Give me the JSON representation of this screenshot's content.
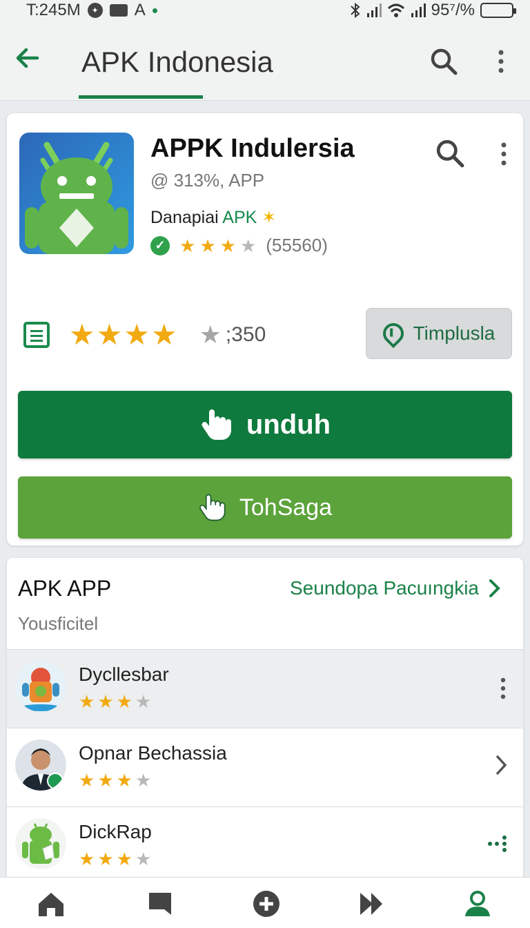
{
  "status_bar": {
    "time": "T:245M",
    "indicator_letter": "A",
    "battery_percent": "95⁷/%"
  },
  "app_bar": {
    "title": "APK Indonesia"
  },
  "app": {
    "name": "APPK Indulersia",
    "meta": "@ 313%, APP",
    "developer_prefix": "Danapiai",
    "developer_link": "APK",
    "rating_stars": 3,
    "rating_count": "(55560)",
    "summary_stars": 4,
    "summary_count": ";350",
    "tag_button": "Timplusla",
    "primary_button": "unduh",
    "secondary_button": "TohSaga"
  },
  "section": {
    "title": "APK APP",
    "see_all": "Seundopa Pacuıngkia",
    "subtitle": "Yousficitel",
    "items": [
      {
        "name": "Dycllesbar",
        "stars": 3,
        "action": "more"
      },
      {
        "name": "Opnar Bechassia",
        "stars": 3,
        "action": "chevron"
      },
      {
        "name": "DickRap",
        "stars": 3,
        "action": "share"
      }
    ]
  },
  "colors": {
    "brand_green": "#0f7a3e",
    "light_green": "#5ca33b",
    "star": "#f2aa12"
  }
}
